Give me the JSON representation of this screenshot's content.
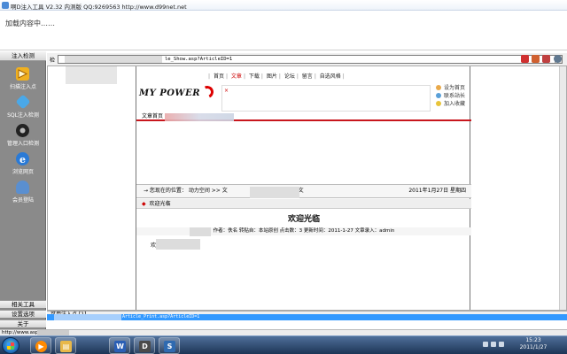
{
  "window": {
    "title": "啊D注入工具 V2.32 内测版 QQ:9269563 http://www.d99net.net"
  },
  "loading": {
    "text": "加载内容中……"
  },
  "sidebar": {
    "header": "注入检测",
    "items": [
      {
        "label": "扫描注入点",
        "icon": "scan-arrow-icon",
        "color": "#f0b020"
      },
      {
        "label": "SQL注入检测",
        "icon": "sql-gear-icon",
        "color": "#4aa8e8"
      },
      {
        "label": "管理入口检测",
        "icon": "admin-entry-icon",
        "color": "#333333"
      },
      {
        "label": "浏览网页",
        "icon": "ie-browser-icon",
        "color": "#2a7ad6"
      },
      {
        "label": "会员登陆",
        "icon": "member-login-icon",
        "color": "#5a8fd0"
      }
    ],
    "footers": [
      "相关工具",
      "设置选项",
      "关于"
    ]
  },
  "address": {
    "label": "检",
    "url": "le_Show.asp?ArticleID=1"
  },
  "page": {
    "nav": [
      "首页",
      "文章",
      "下载",
      "图片",
      "论坛",
      "留言",
      "自选风格"
    ],
    "nav_active_index": 1,
    "logo_text": "MY POWER",
    "ad_close": "×",
    "side_links": [
      "设为首页",
      "联系站长",
      "加入收藏"
    ],
    "subnav_label": "文章首页",
    "crumb_prefix": "→ 您现在的位置：",
    "crumb_mid": "动力空间 >> 文",
    "crumb_end": ">> 正文",
    "date": "2011年1月27日 星期四",
    "welcome_label": "欢迎光临",
    "article_title": "欢迎光临",
    "article_meta": "作者：佚名    转贴自：本站原创    点击数：3    更新时间：2011-1-27    文章录入：admin",
    "article_body": "欢"
  },
  "bottom": {
    "inject_label": "可用注入点 [1]",
    "highlight_url": "Article_Print.asp?ArticleID=1",
    "status_url": "http://www.asp163.net/"
  },
  "taskbar": {
    "time": "15:23",
    "date": "2011/1/27",
    "buttons": [
      {
        "name": "media-player",
        "glyph": "▶",
        "color": "#ff8a00"
      },
      {
        "name": "file-explorer",
        "glyph": "▤",
        "color": "#e8b84a"
      },
      {
        "name": "word",
        "glyph": "W",
        "color": "#2b5fb5"
      },
      {
        "name": "injection-tool",
        "glyph": "D",
        "color": "#4a4a4a"
      },
      {
        "name": "sql-tool",
        "glyph": "S",
        "color": "#2f6ab0"
      }
    ]
  }
}
